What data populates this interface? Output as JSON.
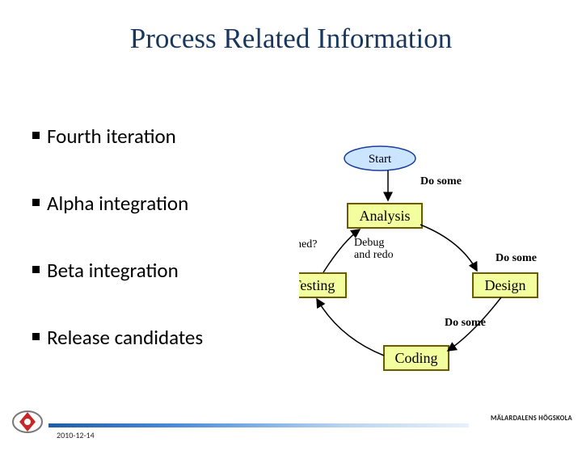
{
  "title": "Process Related Information",
  "bullets": [
    "Fourth iteration",
    "Alpha integration",
    "Beta integration",
    "Release candidates"
  ],
  "diagram": {
    "nodes": {
      "start": {
        "label": "Start",
        "fill": "#CBE4FF",
        "stroke": "#1A3E9C"
      },
      "analysis": {
        "label": "Analysis",
        "fill": "#F3FF9F",
        "stroke": "#6A5B00"
      },
      "design": {
        "label": "Design",
        "fill": "#F3FF9F",
        "stroke": "#6A5B00"
      },
      "coding": {
        "label": "Coding",
        "fill": "#F3FF9F",
        "stroke": "#6A5B00"
      },
      "testing": {
        "label": "Testing",
        "fill": "#F3FF9F",
        "stroke": "#6A5B00"
      }
    },
    "edge_labels": {
      "start_analysis": "Do some",
      "analysis_design": "Do some",
      "design_coding": "Do some",
      "coding_testing": "",
      "testing_analysis_redo": "Debug\nand redo",
      "testing_finished": "Finished?"
    }
  },
  "footer": {
    "date": "2010-12-14",
    "right_logo_text": "MÄLARDALENS HÖGSKOLA"
  }
}
